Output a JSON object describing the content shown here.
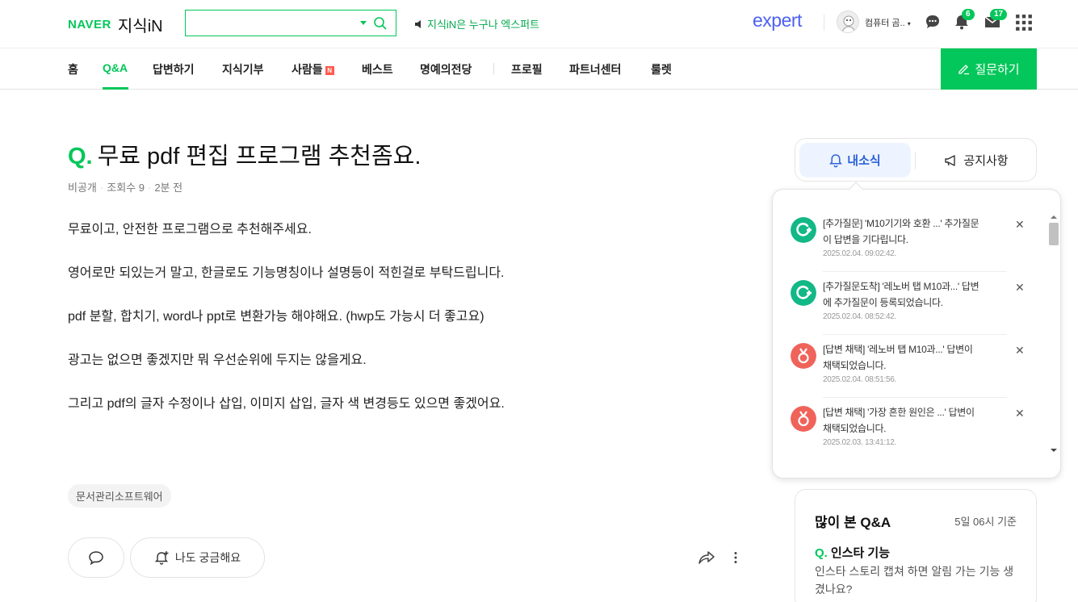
{
  "header": {
    "naver": "NAVER",
    "service": "지식iN",
    "search_value": "",
    "promo_text": "지식iN은 누구나 엑스퍼트",
    "expert_logo": "expert",
    "user_name": "컴퓨터 곰..",
    "notification_count": "6",
    "message_count": "17",
    "brand_color": "#03c75a"
  },
  "nav": {
    "items": [
      "홈",
      "Q&A",
      "답변하기",
      "지식기부",
      "사람들",
      "베스트",
      "명예의전당",
      "프로필",
      "파트너센터",
      "룰렛"
    ],
    "new_badge": "N",
    "ask_button": "질문하기"
  },
  "question": {
    "q_mark": "Q.",
    "title": "무료 pdf 편집 프로그램 추천좀요.",
    "meta_private": "비공개",
    "meta_views": "조회수 9",
    "meta_time": "2분 전",
    "body": [
      "무료이고, 안전한 프로그램으로 추천해주세요.",
      "영어로만 되있는거 말고, 한글로도 기능명칭이나 설명등이 적힌걸로 부탁드립니다.",
      "pdf 분할, 합치기, word나 ppt로 변환가능 해야해요. (hwp도 가능시 더 좋고요)",
      "광고는 없으면 좋겠지만 뭐 우선순위에 두지는 않을게요.",
      "그리고 pdf의 글자 수정이나 삽입, 이미지 삽입, 글자 색 변경등도 있으면 좋겠어요."
    ],
    "tag": "문서관리소프트웨어",
    "curious_button": "나도 궁금해요"
  },
  "tabs": {
    "my_news": "내소식",
    "notice": "공지사항"
  },
  "notifications": [
    {
      "text": "[추가질문] 'M10기기와 호환 ...' 추가질문이 답변을 기다립니다.",
      "time": "2025.02.04. 09:02:42.",
      "icon": "additional-question-icon",
      "color": "#12b886"
    },
    {
      "text": "[추가질문도착] '레노버 탭 M10과...' 답변에 추가질문이 등록되었습니다.",
      "time": "2025.02.04. 08:52:42.",
      "icon": "additional-question-icon",
      "color": "#12b886"
    },
    {
      "text": "[답변 채택] '레노버 탭 M10과...' 답변이 채택되었습니다.",
      "time": "2025.02.04. 08:51:56.",
      "icon": "medal-icon",
      "color": "#f0635a"
    },
    {
      "text": "[답변 채택] '가장 흔한 원인은 ...' 답변이 채택되었습니다.",
      "time": "2025.02.03. 13:41:12.",
      "icon": "medal-icon",
      "color": "#f0635a"
    }
  ],
  "popular": {
    "title": "많이 본 Q&A",
    "time": "5일 06시 기준",
    "q_mark": "Q.",
    "question": "인스타 기능",
    "desc": "인스타 스토리 캡쳐 하면 알림 가는 기능 생겼나요?"
  }
}
